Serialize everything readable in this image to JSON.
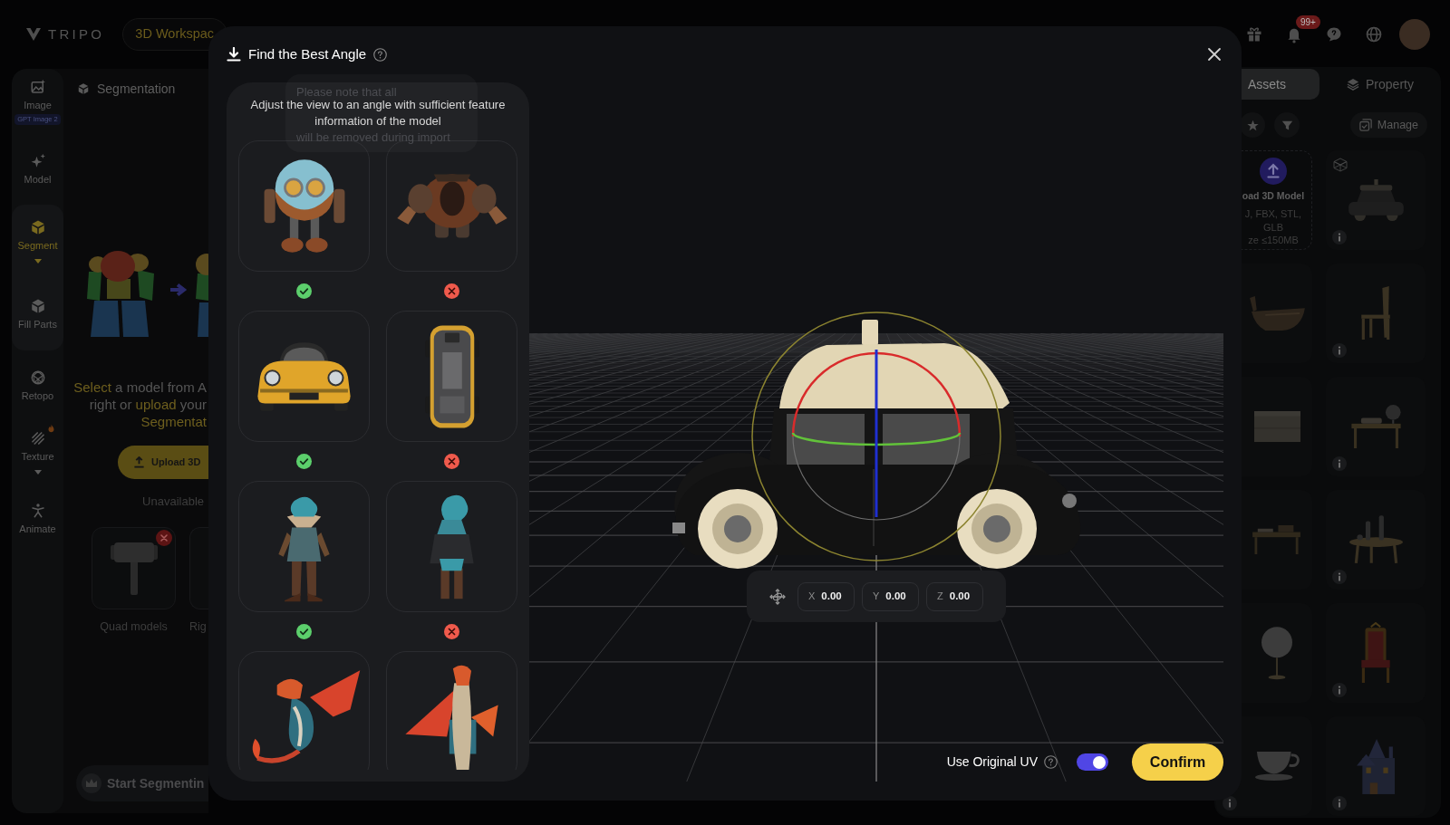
{
  "topbar": {
    "logo": "TRIPO",
    "workspace": "3D Workspac",
    "notifications": "99+"
  },
  "sidebar": {
    "items": [
      {
        "label": "Image",
        "badge": "GPT Image 2",
        "selected": false,
        "hot": false
      },
      {
        "label": "Model",
        "selected": false,
        "hot": false
      },
      {
        "label": "Segment",
        "selected": true,
        "hot": false,
        "expanded": true,
        "children": [
          {
            "label": "Fill Parts",
            "selected": false,
            "hot": false
          }
        ]
      },
      {
        "label": "Retopo",
        "selected": false,
        "hot": false
      },
      {
        "label": "Texture",
        "selected": false,
        "hot": true,
        "expanded": false
      },
      {
        "label": "Animate",
        "selected": false,
        "hot": false
      }
    ]
  },
  "segmentation": {
    "title": "Segmentation",
    "prompt": [
      [
        {
          "text": "Select",
          "kind": "link"
        },
        {
          "text": " a model from A",
          "kind": "plain"
        }
      ],
      [
        {
          "text": "right or ",
          "kind": "plain"
        },
        {
          "text": "upload",
          "kind": "link"
        },
        {
          "text": " your",
          "kind": "plain"
        }
      ],
      [
        {
          "text": "Segmentat",
          "kind": "accent"
        }
      ]
    ],
    "upload_button": "Upload 3D",
    "unavailable_label": "Unavailable",
    "unavailable": [
      {
        "label": "Quad models",
        "kind": "hammer"
      },
      {
        "label": "Rig",
        "kind": "blank"
      }
    ],
    "start_button": "Start Segmentin"
  },
  "assets_panel": {
    "tabs": [
      {
        "label": "Assets",
        "selected": true
      },
      {
        "label": "Property",
        "selected": false
      }
    ],
    "manage_button": "Manage",
    "upload_card": {
      "title": "oad 3D Model",
      "details": [
        "J, FBX, STL,",
        "GLB",
        "ze ≤150MB"
      ]
    },
    "items": [
      {
        "kind": "car",
        "wireframe": true,
        "info": true
      },
      {
        "kind": "boat",
        "wireframe": false,
        "info": false
      },
      {
        "kind": "chair",
        "wireframe": false,
        "info": true
      },
      {
        "kind": "crate",
        "wireframe": false,
        "info": false
      },
      {
        "kind": "globe",
        "wireframe": false,
        "info": true
      },
      {
        "kind": "desk",
        "wireframe": false,
        "info": false
      },
      {
        "kind": "table",
        "wireframe": false,
        "info": true
      },
      {
        "kind": "mirror",
        "wireframe": false,
        "info": false
      },
      {
        "kind": "throne",
        "wireframe": false,
        "info": true
      },
      {
        "kind": "teacup",
        "wireframe": false,
        "info": true
      },
      {
        "kind": "house",
        "wireframe": false,
        "info": true
      }
    ]
  },
  "dialog": {
    "title": "Find the Best Angle",
    "instruction": "Adjust the view to an angle with sufficient feature information of the model",
    "tooltip": [
      "Please note that all",
      "will be removed during import"
    ],
    "examples": [
      {
        "kind": "robotfront",
        "correct": true
      },
      {
        "kind": "robotback",
        "correct": false
      },
      {
        "kind": "carfront",
        "correct": true
      },
      {
        "kind": "carbottom",
        "correct": false
      },
      {
        "kind": "elffront",
        "correct": true
      },
      {
        "kind": "elfback",
        "correct": false
      },
      {
        "kind": "dragonside"
      },
      {
        "kind": "dragonback"
      }
    ],
    "position": [
      {
        "axis": "X",
        "value": "0.00"
      },
      {
        "axis": "Y",
        "value": "0.00"
      },
      {
        "axis": "Z",
        "value": "0.00"
      }
    ],
    "use_original_uv": {
      "label": "Use Original UV",
      "on": true
    },
    "confirm": "Confirm"
  }
}
